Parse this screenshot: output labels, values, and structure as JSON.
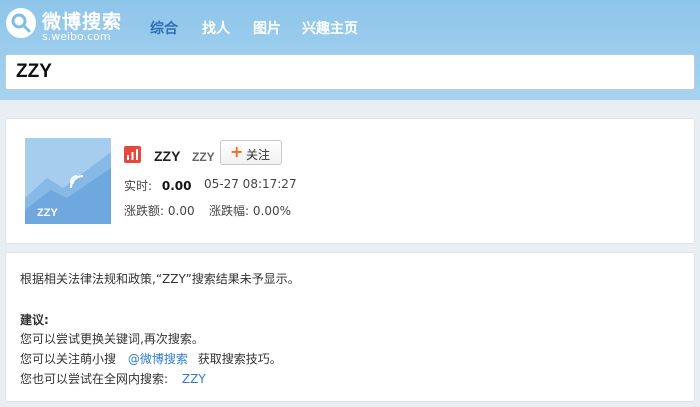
{
  "brand": {
    "name": "微博搜索",
    "domain": "s.weibo.com"
  },
  "nav": {
    "tabs": [
      {
        "label": "综合",
        "active": true
      },
      {
        "label": "找人",
        "active": false
      },
      {
        "label": "图片",
        "active": false
      },
      {
        "label": "兴趣主页",
        "active": false
      }
    ]
  },
  "search": {
    "query": "ZZY"
  },
  "stock": {
    "image_label": "ZZY",
    "name": "ZZY",
    "code": "ZZY",
    "follow_label": "关注",
    "realtime_label": "实时:",
    "realtime_value": "0.00",
    "datetime": "05-27 08:17:27",
    "change_amount_label": "涨跌额:",
    "change_amount_value": "0.00",
    "change_pct_label": "涨跌幅:",
    "change_pct_value": "0.00%"
  },
  "notice": {
    "message": "根据相关法律法规和政策,“ZZY”搜索结果未予显示。",
    "suggestion_title": "建议:",
    "line1": "您可以尝试更换关键词,再次搜索。",
    "line2_prefix": "您可以关注萌小搜",
    "line2_link": "@微博搜索",
    "line2_suffix": "获取搜索技巧。",
    "line3_prefix": "您也可以尝试在全网内搜索:",
    "line3_link": "ZZY"
  },
  "colors": {
    "header_bg": "#9ccdec",
    "active_tab": "#2f6fb8",
    "link": "#2f7cc9",
    "follow_plus": "#f36c21"
  }
}
